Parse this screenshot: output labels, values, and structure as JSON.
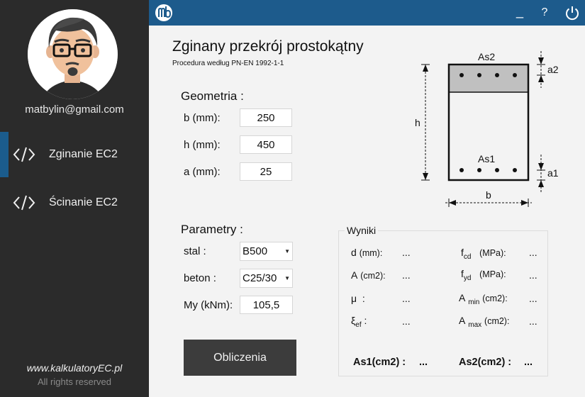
{
  "user": {
    "email": "matbylin@gmail.com"
  },
  "nav": [
    {
      "label": "Zginanie EC2",
      "icon": "code-icon",
      "active": true
    },
    {
      "label": "Ścinanie EC2",
      "icon": "code-icon",
      "active": false
    }
  ],
  "footer": {
    "site": "www.kalkulatoryEC.pl",
    "rights": "All rights reserved"
  },
  "titlebar": {
    "minimize": "_",
    "help": "?",
    "logo_icon": "mb-logo-icon",
    "power_icon": "power-icon"
  },
  "page": {
    "title": "Zginany przekrój prostokątny",
    "subtitle": "Procedura według PN-EN 1992-1-1"
  },
  "geometry": {
    "heading": "Geometria :",
    "b_label": "b (mm):",
    "b_value": "250",
    "h_label": "h (mm):",
    "h_value": "450",
    "a_label": "a (mm):",
    "a_value": "25"
  },
  "params": {
    "heading": "Parametry :",
    "steel_label": "stal :",
    "steel_value": "B500",
    "concrete_label": "beton :",
    "concrete_value": "C25/30",
    "moment_label": "My (kNm):",
    "moment_value": "105,5"
  },
  "calc_button": "Obliczenia",
  "results": {
    "title": "Wyniki",
    "d_sym": "d",
    "d_unit": "(mm):",
    "d_val": "...",
    "A_sym": "A",
    "A_unit": "(cm2):",
    "A_val": "...",
    "mu_sym": "μ",
    "mu_colon": ":",
    "mu_val": "...",
    "xi_sym": "ξ",
    "xi_sub": "ef",
    "xi_colon": ":",
    "xi_val": "...",
    "fcd_sym": "f",
    "fcd_sub": "cd",
    "fcd_unit": "(MPa):",
    "fcd_val": "...",
    "fyd_sym": "f",
    "fyd_sub": "yd",
    "fyd_unit": "(MPa):",
    "fyd_val": "...",
    "amin_sym": "A",
    "amin_sub": "min",
    "amin_unit": "(cm2):",
    "amin_val": "...",
    "amax_sym": "A",
    "amax_sub": "max",
    "amax_unit": "(cm2):",
    "amax_val": "...",
    "as1_label": "As1(cm2) :",
    "as1_val": "...",
    "as2_label": "As2(cm2) :",
    "as2_val": "..."
  },
  "diagram": {
    "as2": "As2",
    "as1": "As1",
    "a2": "a2",
    "a1": "a1",
    "h": "h",
    "b": "b",
    "compression_fill": "#c0c0c0"
  },
  "colors": {
    "sidebar": "#2b2b2b",
    "titlebar": "#1d5b8c",
    "accent": "#1b5c8d",
    "button": "#3c3c3c"
  }
}
